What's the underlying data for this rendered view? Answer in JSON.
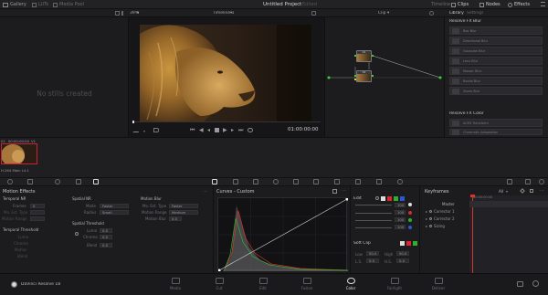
{
  "topbar": {
    "gallery": "Gallery",
    "luts": "LUTs",
    "media_pool": "Media Pool",
    "project_title": "Untitled Project",
    "edited": "Edited",
    "timeline": "Timeline",
    "clips": "Clips",
    "nodes": "Nodes",
    "effects": "Effects"
  },
  "subbar": {
    "zoom": "39%",
    "timeline_name": "Timeline 1",
    "clip_mode": "Clip",
    "library_tab": "Library",
    "settings_tab": "Settings"
  },
  "gallery": {
    "empty_message": "No stills created"
  },
  "viewer": {
    "timecode": "01:00:00:00"
  },
  "nodes": {
    "node1": "01",
    "node2": "02"
  },
  "library": {
    "section1": "Resolve FX Blur",
    "blur_items": [
      "Box Blur",
      "Directional Blur",
      "Gaussian Blur",
      "Lens Blur",
      "Mosaic Blur",
      "Radial Blur",
      "Zoom Blur"
    ],
    "section2": "Resolve FX Color",
    "color_items": [
      "ACES Transform",
      "Chromatic Adaptation"
    ]
  },
  "clip": {
    "number": "01",
    "timecode": "00:00:00:00",
    "track": "V1",
    "codec": "H.264 Main L4.1"
  },
  "motion": {
    "title": "Motion Effects",
    "temporal_nr": "Temporal NR",
    "frames_label": "Frames",
    "frames_value": "0",
    "mo_est_type_label": "Mo. Est. Type",
    "motion_range_label": "Motion Range",
    "temporal_threshold": "Temporal Threshold",
    "luma_label": "Luma",
    "chroma_label": "Chroma",
    "motion_label": "Motion",
    "blend_label": "Blend",
    "spatial_nr": "Spatial NR",
    "mode_label": "Mode",
    "mode_value": "Faster",
    "radius_label": "Radius",
    "radius_value": "Small",
    "spatial_threshold": "Spatial Threshold",
    "luma_value": "0.0",
    "chroma_value": "0.0",
    "blend_value": "0.0",
    "motion_blur": "Motion Blur",
    "mb_mo_est_label": "Mo. Est. Type",
    "mb_mo_est_value": "Faster",
    "mb_range_label": "Motion Range",
    "mb_range_value": "Medium",
    "mb_blur_label": "Motion Blur",
    "mb_blur_value": "0.0"
  },
  "curves": {
    "title": "Curves - Custom"
  },
  "edit": {
    "title": "Edit",
    "values": [
      "100",
      "100",
      "100",
      "100"
    ],
    "soft_clip": "Soft Clip",
    "low_label": "Low",
    "low_value": "50.0",
    "high_label": "High",
    "high_value": "50.0",
    "ls_label": "L.S.",
    "ls_value": "0.0",
    "hs_label": "H.S.",
    "hs_value": "0.0"
  },
  "keyframes": {
    "title": "Keyframes",
    "all": "All",
    "master": "Master",
    "rows": [
      "Corrector 1",
      "Corrector 2",
      "Sizing"
    ],
    "timecode": "00:00:00:00"
  },
  "footer": {
    "app_name": "DaVinci Resolve 18",
    "pages": [
      "Media",
      "Cut",
      "Edit",
      "Fusion",
      "Color",
      "Fairlight",
      "Deliver"
    ],
    "active_page": "Color"
  },
  "colors": {
    "accent_red": "#e2232e",
    "playhead_red": "#d9342c",
    "node_green": "#3ad03a",
    "node_yellow": "#e8d23a"
  }
}
